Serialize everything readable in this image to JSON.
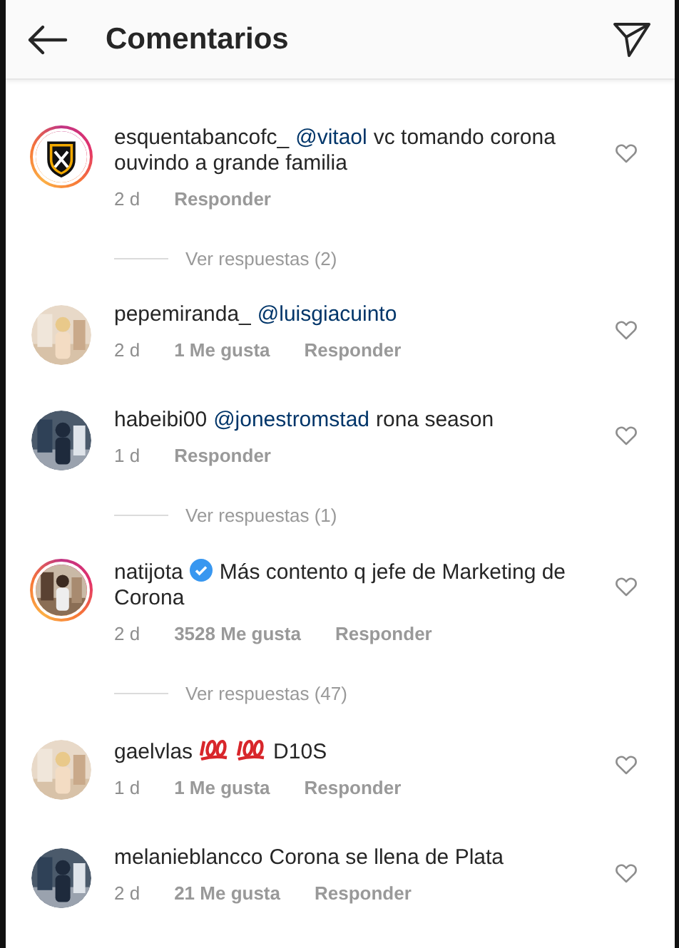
{
  "header": {
    "title": "Comentarios"
  },
  "items": [
    {
      "kind": "comment",
      "username": "esquentabancofc_",
      "story_ring": true,
      "verified": false,
      "avatar": {
        "kind": "logo"
      },
      "parts": [
        {
          "kind": "mention",
          "text": "@vitaol"
        },
        {
          "kind": "text",
          "text": "vc tomando corona ouvindo a grande familia"
        }
      ],
      "time": "2 d",
      "reply": "Responder"
    },
    {
      "kind": "replies",
      "text": "Ver respuestas (2)"
    },
    {
      "kind": "comment",
      "username": "pepemiranda_",
      "story_ring": false,
      "verified": false,
      "avatar": {
        "kind": "picture"
      },
      "parts": [
        {
          "kind": "mention",
          "text": "@luisgiacuinto"
        }
      ],
      "time": "2 d",
      "likes": "1 Me gusta",
      "reply": "Responder"
    },
    {
      "kind": "comment",
      "username": "habeibi00",
      "story_ring": false,
      "verified": false,
      "avatar": {
        "kind": "picture"
      },
      "parts": [
        {
          "kind": "mention",
          "text": "@jonestromstad"
        },
        {
          "kind": "text",
          "text": "rona season"
        }
      ],
      "time": "1 d",
      "reply": "Responder"
    },
    {
      "kind": "replies",
      "text": "Ver respuestas (1)"
    },
    {
      "kind": "comment",
      "username": "natijota",
      "story_ring": true,
      "verified": true,
      "avatar": {
        "kind": "picture"
      },
      "parts": [
        {
          "kind": "text",
          "text": "Más contento q jefe de Marketing de Corona"
        }
      ],
      "time": "2 d",
      "likes": "3528 Me gusta",
      "reply": "Responder"
    },
    {
      "kind": "replies",
      "text": "Ver respuestas (47)"
    },
    {
      "kind": "comment",
      "username": "gaelvlas",
      "story_ring": false,
      "verified": false,
      "avatar": {
        "kind": "picture"
      },
      "parts": [
        {
          "kind": "emoji"
        },
        {
          "kind": "emoji"
        },
        {
          "kind": "text",
          "text": "D10S"
        }
      ],
      "time": "1 d",
      "likes": "1 Me gusta",
      "reply": "Responder"
    },
    {
      "kind": "comment",
      "username": "melanieblancco",
      "story_ring": false,
      "verified": false,
      "avatar": {
        "kind": "picture"
      },
      "parts": [
        {
          "kind": "text",
          "text": "Corona se llena de Plata"
        }
      ],
      "time": "2 d",
      "likes": "21 Me gusta",
      "reply": "Responder"
    }
  ]
}
